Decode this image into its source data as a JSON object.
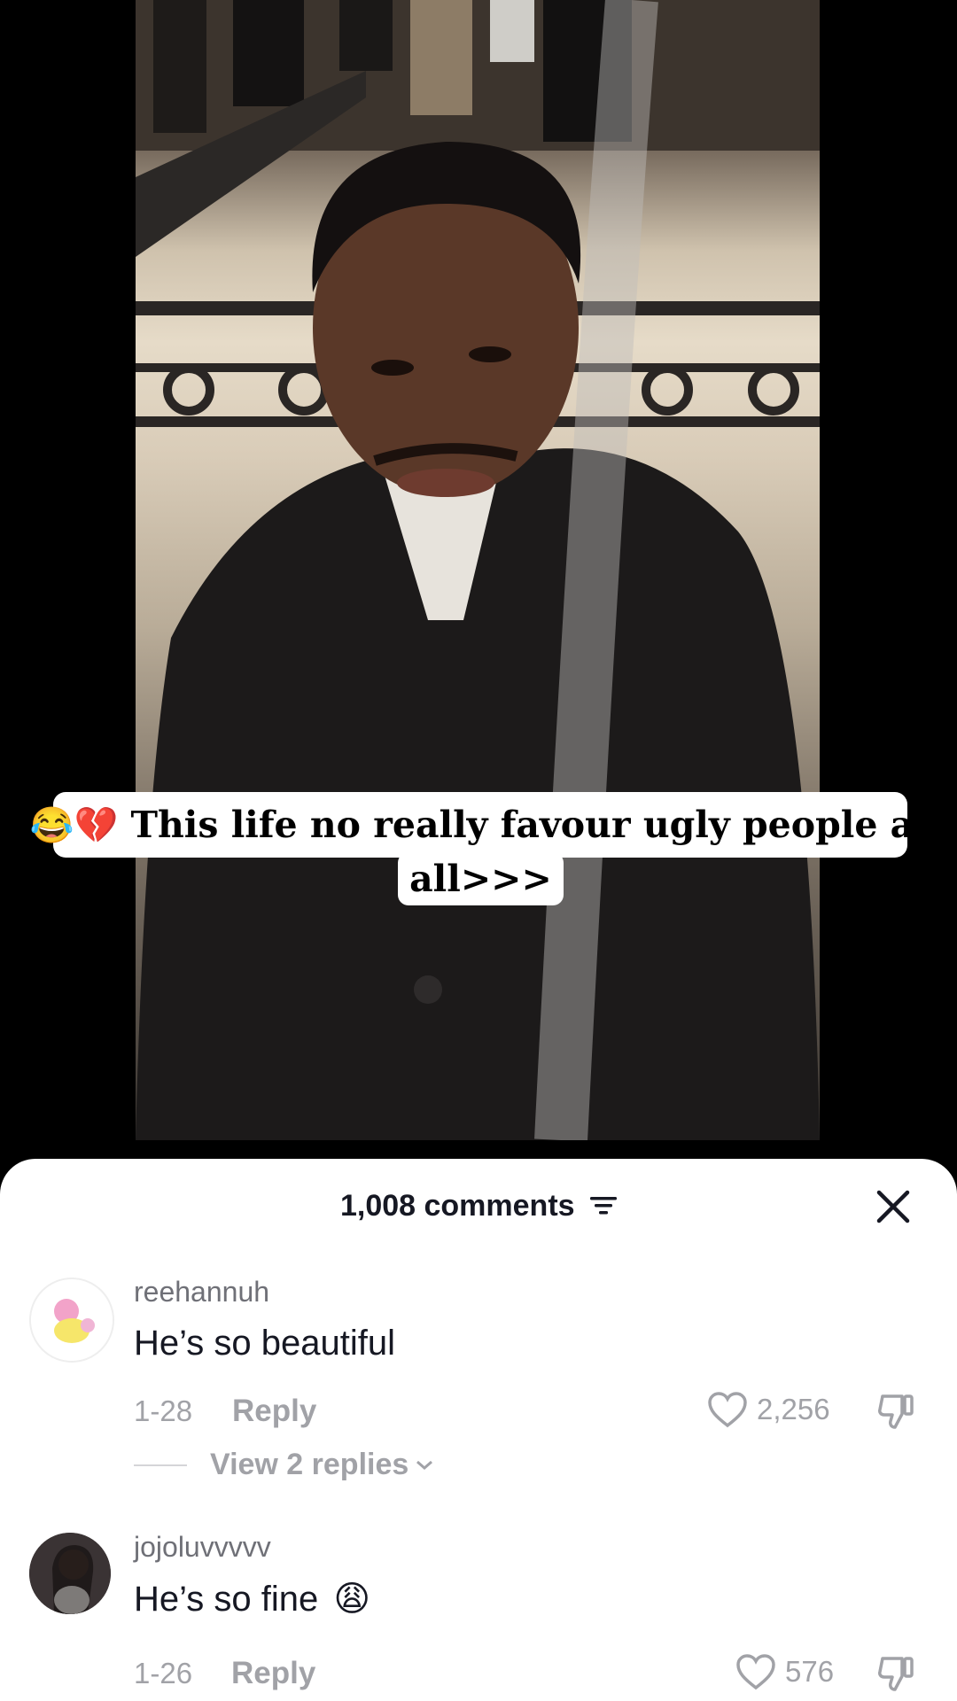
{
  "caption": {
    "emojis": "😂💔",
    "line1": "This life no really favour ugly people at",
    "line2": "all>>>"
  },
  "comments_panel": {
    "count_label": "1,008 comments",
    "close_icon": "close-icon",
    "sort_icon": "sort-icon"
  },
  "comments": [
    {
      "username": "reehannuh",
      "text": "He’s so beautiful",
      "date": "1-28",
      "reply_label": "Reply",
      "likes": "2,256",
      "view_replies": "View 2 replies"
    },
    {
      "username": "jojoluvvvvv",
      "text": "He’s so fine",
      "text_emoji": "😩",
      "date": "1-26",
      "reply_label": "Reply",
      "likes": "576"
    }
  ],
  "colors": {
    "sheet_bg": "#ffffff",
    "primary_text": "#161823",
    "secondary_text": "#a1a2a7"
  }
}
